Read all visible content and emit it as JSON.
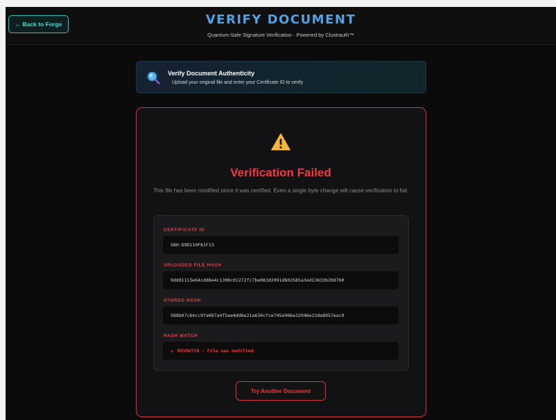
{
  "header": {
    "back_label": "← Back to Forge",
    "title": "VERIFY DOCUMENT",
    "subtitle": "Quantum-Safe Signature Verification · Powered by Clustrauth™"
  },
  "info": {
    "icon": "magnifier-icon",
    "title": "Verify Document Authenticity",
    "subtitle": "Upload your original file and enter your Certificate ID to verify"
  },
  "result": {
    "status_icon": "warning-icon",
    "title": "Verification Failed",
    "description": "This file has been modified since it was certified. Even a single byte change will cause verification to fail.",
    "fields": {
      "certificate_id": {
        "label": "CERTIFICATE ID",
        "value": "S8H-D9D110F81F13"
      },
      "uploaded_hash": {
        "label": "UPLOADED FILE HASH",
        "value": "9ddd1113e64cdd8e4c1308c01272fc7be083d2091db02585a3ed13633b20d7b0"
      },
      "stored_hash": {
        "label": "STORED HASH",
        "value": "588b07c64cc9fa087a4f5ae4dd6e21a630cfce745e906e32946e23de8957eac9"
      },
      "hash_match": {
        "label": "HASH MATCH",
        "mark": "✕",
        "value": "MISMATCH - File was modified"
      }
    },
    "retry_label": "Try Another Document"
  },
  "colors": {
    "accent_teal": "#2cc4b5",
    "title_blue": "#4fa3e6",
    "error_red": "#ef3b3f",
    "background": "#0b0b0c"
  }
}
